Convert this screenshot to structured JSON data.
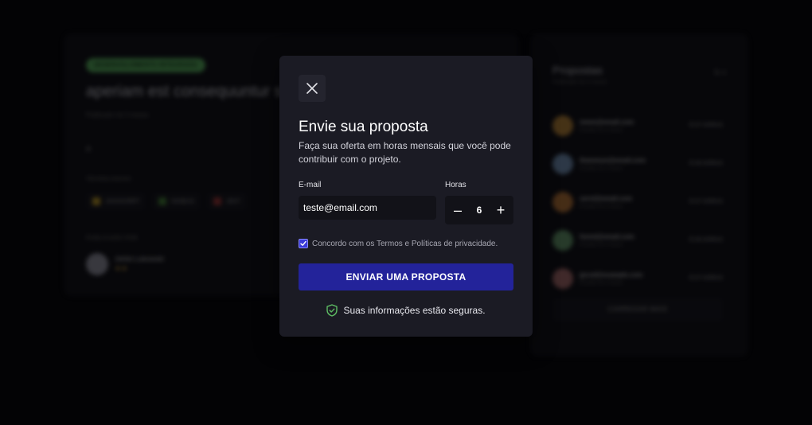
{
  "background": {
    "project": {
      "badge": "DESENVOLVIMENTO INTEGRADO",
      "title": "aperiam est consequuntur se",
      "published": "Publicado há 3 meses",
      "description": "A",
      "techs_label": "TECNOLOGIAS",
      "techs": [
        {
          "name": "JAVASCRIPT",
          "color": "#c9a227"
        },
        {
          "name": "NODEJS",
          "color": "#4a8a3a"
        },
        {
          "name": "JEST",
          "color": "#a83a3a"
        }
      ],
      "author_label": "PUBLICADO POR",
      "author_name": "Jehile Lubowski",
      "author_stars": "★★"
    },
    "proposals": {
      "title": "Propostas",
      "subtitle": "Publicado há 3 meses",
      "filter": "⇅ ≡",
      "items": [
        {
          "email": "mmm@email.com",
          "date": "Enviado há 3 meses",
          "hours": "⏱ 07 HORAS",
          "color": "#c08a3a"
        },
        {
          "email": "thammun@email.com",
          "date": "Enviado há 3 meses",
          "hours": "⏱ 08 HORAS",
          "color": "#7a9ac0"
        },
        {
          "email": "servt@email.com",
          "date": "Enviado há 3 meses",
          "hours": "⏱ 07 HORAS",
          "color": "#c07a3a"
        },
        {
          "email": "fsmnt@email.com",
          "date": "Enviado há 3 meses",
          "hours": "⏱ 08 HORAS",
          "color": "#6aa070"
        },
        {
          "email": "jpcsd@example.com",
          "date": "Enviado há 3 meses",
          "hours": "⏱ 07 HORAS",
          "color": "#b07070"
        }
      ],
      "load_more": "CARREGAR MAIS"
    }
  },
  "modal": {
    "title": "Envie sua proposta",
    "description": "Faça sua oferta em horas mensais que você pode contribuir com o projeto.",
    "email_label": "E-mail",
    "email_value": "teste@email.com",
    "hours_label": "Horas",
    "hours_value": "6",
    "decrement": "–",
    "increment": "+",
    "terms_text": "Concordo com os Termos e Políticas de privacidade.",
    "terms_checked": true,
    "submit_label": "ENVIAR UMA PROPOSTA",
    "secure_text": "Suas informações estão seguras.",
    "colors": {
      "accent": "#23239a",
      "shield": "#5dbb63"
    }
  }
}
